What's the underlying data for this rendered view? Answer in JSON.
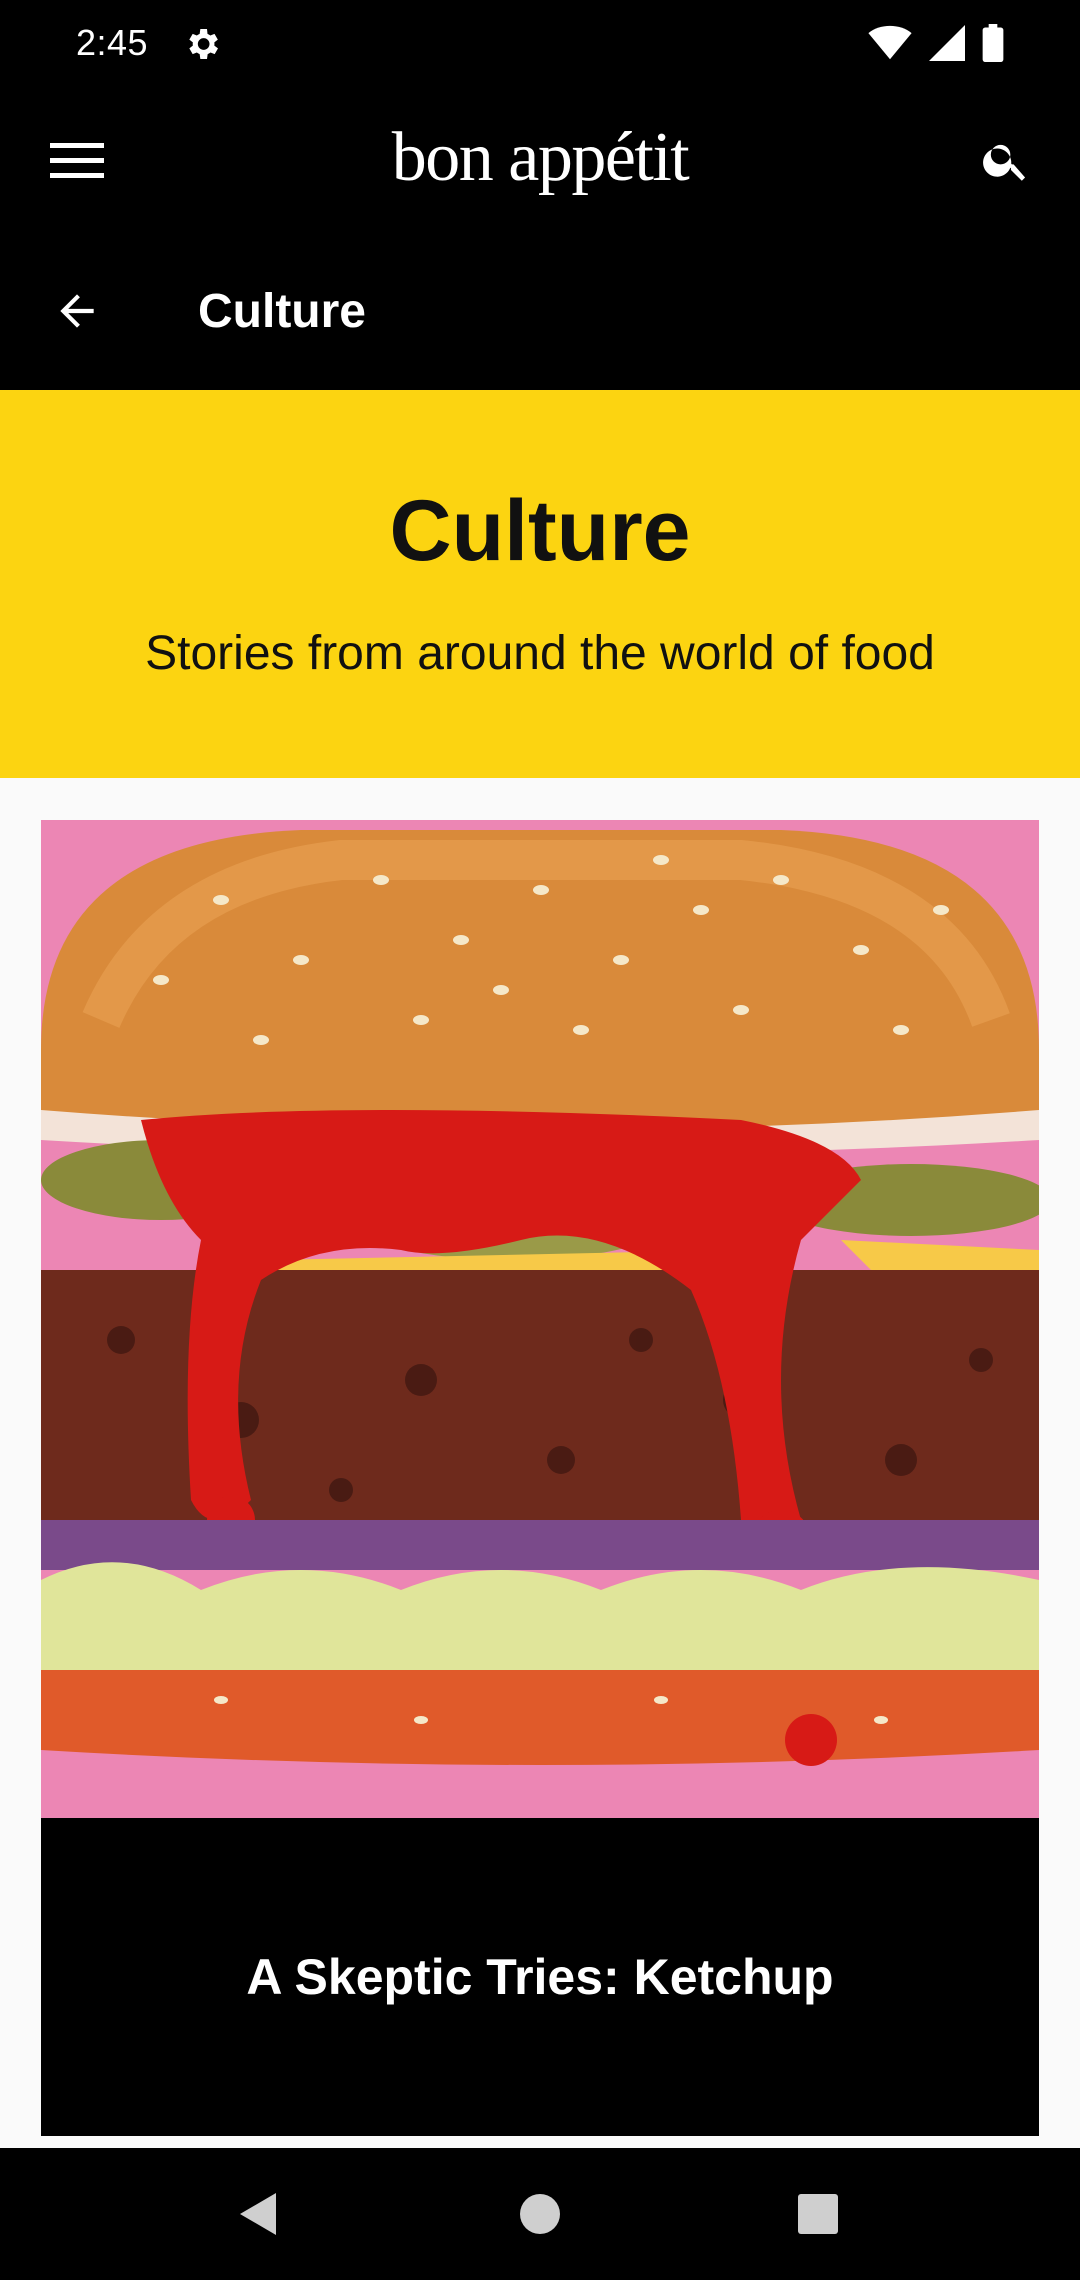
{
  "status_bar": {
    "time": "2:45",
    "icons": [
      "settings-icon",
      "wifi-icon",
      "signal-icon",
      "battery-icon"
    ]
  },
  "app_bar": {
    "brand": "bon appétit",
    "menu_icon": "menu-icon",
    "search_icon": "search-icon"
  },
  "sub_bar": {
    "back_icon": "arrow-back-icon",
    "title": "Culture"
  },
  "hero": {
    "title": "Culture",
    "subtitle": "Stories from around the world of food",
    "color": "#fcd411"
  },
  "card": {
    "title": "A Skeptic Tries: Ketchup",
    "image": "burger-with-ketchup-photo"
  },
  "nav_bar": {
    "buttons": [
      "back-nav-icon",
      "home-nav-icon",
      "recents-nav-icon"
    ]
  }
}
